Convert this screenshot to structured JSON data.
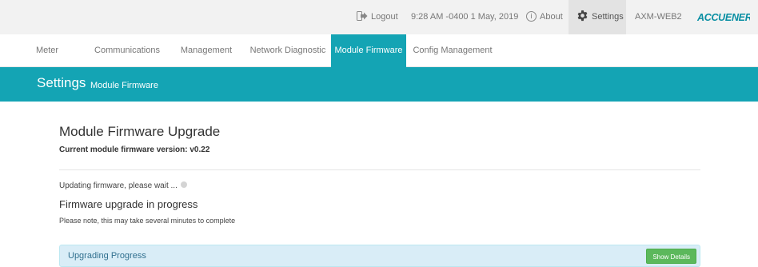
{
  "topbar": {
    "logout_label": "Logout",
    "datetime": "9:28 AM -0400 1 May, 2019",
    "about_label": "About",
    "settings_label": "Settings",
    "device_name": "AXM-WEB2",
    "brand": "ACCUENERGY"
  },
  "tabs": [
    {
      "label": "Meter"
    },
    {
      "label": "Communications"
    },
    {
      "label": "Management"
    },
    {
      "label": "Network Diagnostic"
    },
    {
      "label": "Module Firmware"
    },
    {
      "label": "Config Management"
    }
  ],
  "banner": {
    "title": "Settings",
    "subtitle": "Module Firmware"
  },
  "main": {
    "heading": "Module Firmware Upgrade",
    "version_text": "Current module firmware version: v0.22",
    "updating_text": "Updating firmware, please wait ...",
    "progress_heading": "Firmware upgrade in progress",
    "note": "Please note, this may take several minutes to complete",
    "panel_title": "Upgrading Progress",
    "details_button": "Show Details"
  },
  "colors": {
    "accent": "#14a4b4",
    "panel_bg": "#d9edf7",
    "button_green": "#5cb85c"
  }
}
